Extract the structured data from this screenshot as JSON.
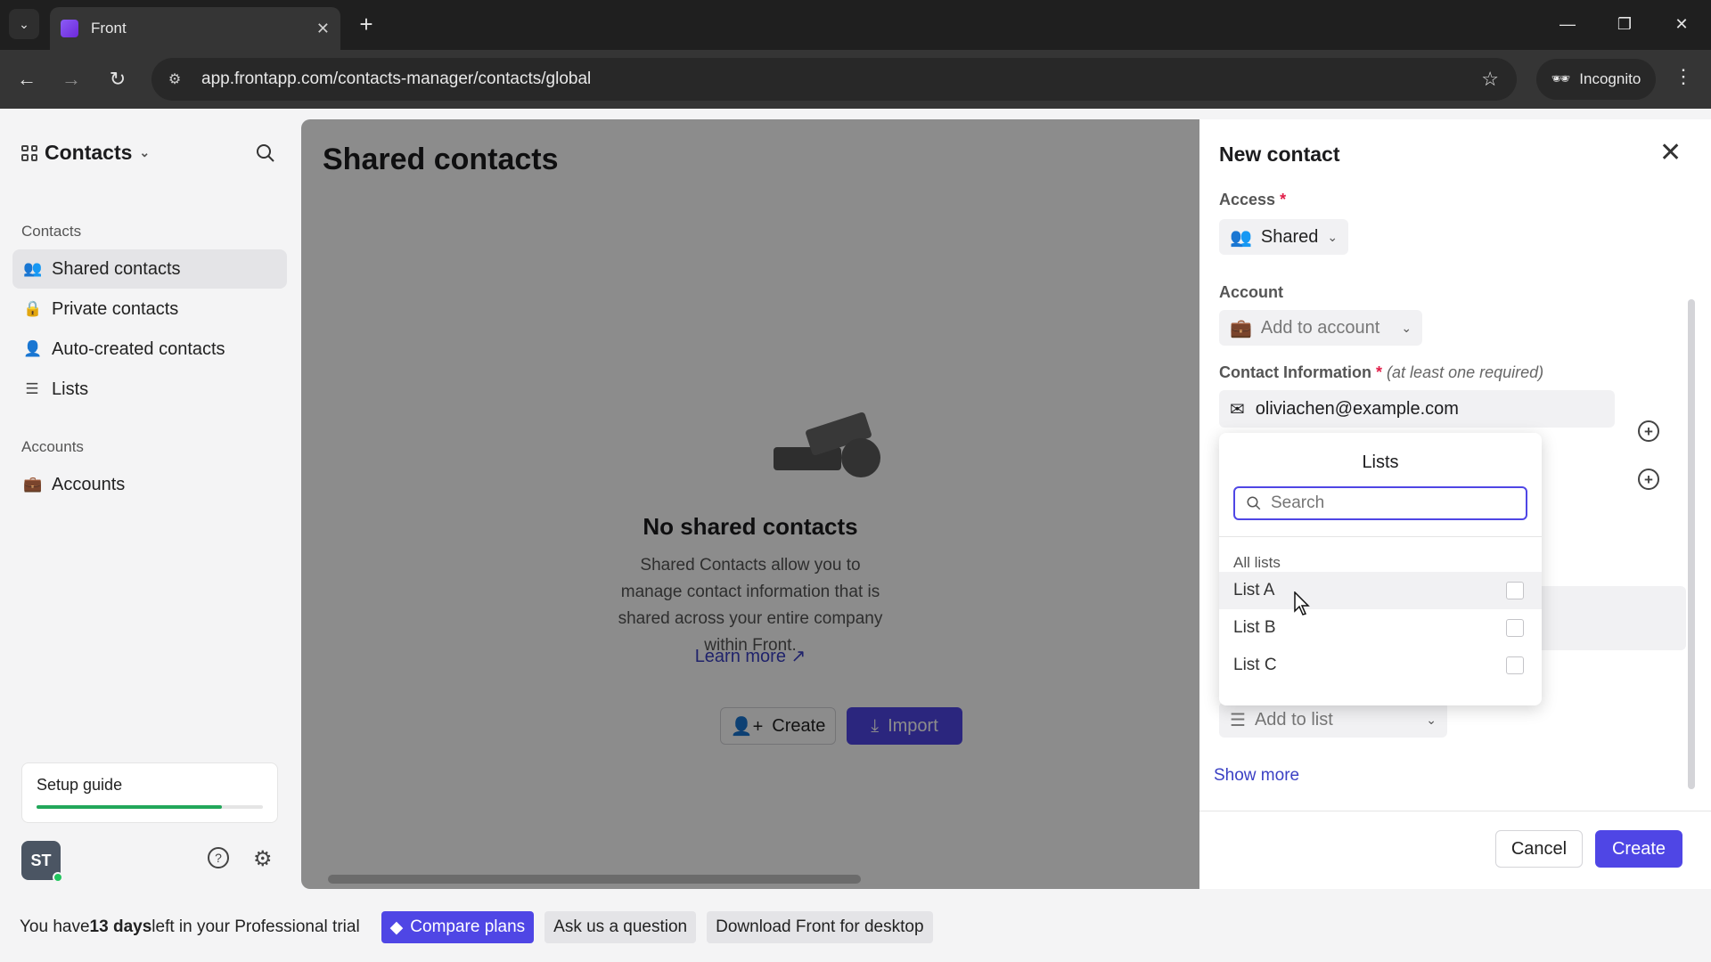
{
  "browser": {
    "tab_title": "Front",
    "url": "app.frontapp.com/contacts-manager/contacts/global",
    "incognito_label": "Incognito"
  },
  "sidebar": {
    "header": "Contacts",
    "section_contacts": "Contacts",
    "items": [
      {
        "label": "Shared contacts",
        "icon": "users-icon"
      },
      {
        "label": "Private contacts",
        "icon": "lock-icon"
      },
      {
        "label": "Auto-created contacts",
        "icon": "user-auto-icon"
      },
      {
        "label": "Lists",
        "icon": "list-icon"
      }
    ],
    "section_accounts": "Accounts",
    "accounts_item": "Accounts",
    "setup_guide": "Setup guide",
    "setup_progress": 0.82,
    "avatar_initials": "ST"
  },
  "main": {
    "title": "Shared contacts",
    "empty_title": "No shared contacts",
    "empty_desc": "Shared Contacts allow you to manage contact information that is shared across your entire company within Front.",
    "learn_more": "Learn more",
    "create_label": "Create",
    "import_label": "Import"
  },
  "panel": {
    "title": "New contact",
    "access_label": "Access",
    "access_value": "Shared",
    "account_label": "Account",
    "account_placeholder": "Add to account",
    "contact_info_label": "Contact Information",
    "contact_info_hint": "(at least one required)",
    "email_value": "oliviachen@example.com",
    "add_to_list": "Add to list",
    "show_more": "Show more",
    "cancel_label": "Cancel",
    "create_label": "Create"
  },
  "lists_dropdown": {
    "title": "Lists",
    "search_placeholder": "Search",
    "section": "All lists",
    "items": [
      "List A",
      "List B",
      "List C"
    ]
  },
  "banner": {
    "text_before": "You have ",
    "days": "13 days",
    "text_after": " left in your Professional trial",
    "compare_plans": "Compare plans",
    "ask_question": "Ask us a question",
    "download": "Download Front for desktop"
  },
  "colors": {
    "accent": "#4f46e5",
    "link": "#3b40c4",
    "progress": "#22a75a"
  }
}
